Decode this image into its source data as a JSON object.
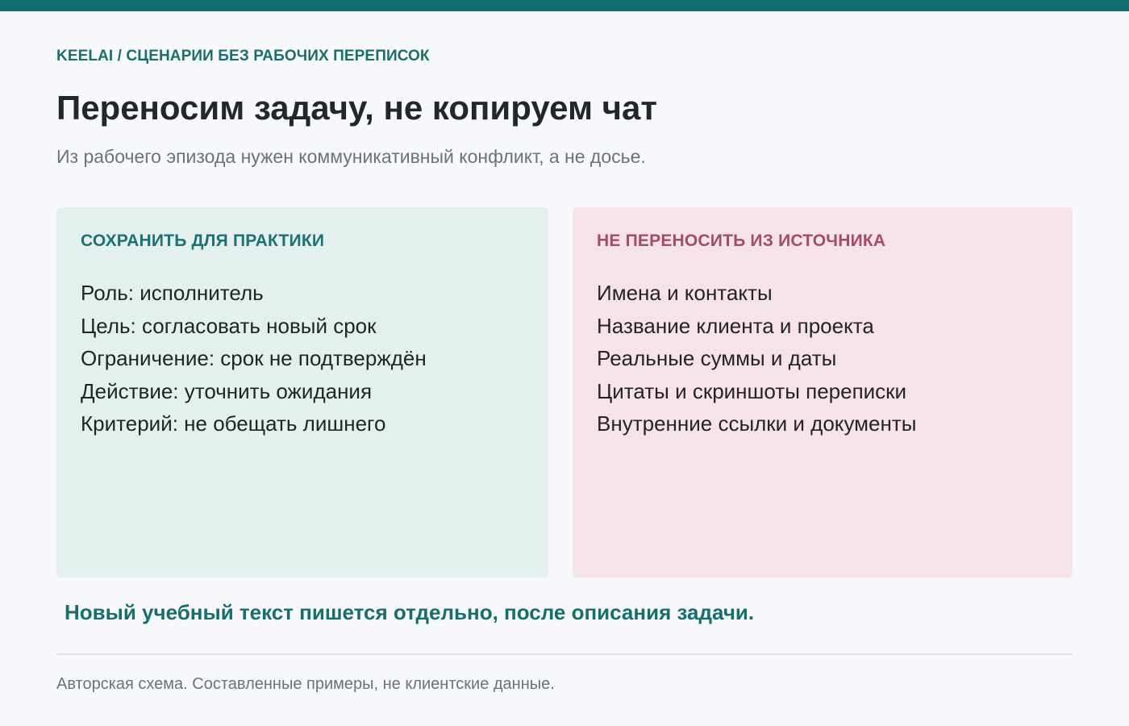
{
  "header": {
    "breadcrumb": "KEELAI / СЦЕНАРИИ БЕЗ РАБОЧИХ ПЕРЕПИСОК",
    "title": "Переносим задачу, не копируем чат",
    "subtitle": "Из рабочего эпизода нужен коммуникативный конфликт, а не досье."
  },
  "panels": {
    "keep": {
      "heading": "СОХРАНИТЬ ДЛЯ ПРАКТИКИ",
      "items": [
        "Роль: исполнитель",
        "Цель: согласовать новый срок",
        "Ограничение: срок не подтверждён",
        "Действие: уточнить ожидания",
        "Критерий: не обещать лишнего"
      ]
    },
    "exclude": {
      "heading": "НЕ ПЕРЕНОСИТЬ ИЗ ИСТОЧНИКА",
      "items": [
        "Имена и контакты",
        "Название клиента и проекта",
        "Реальные суммы и даты",
        "Цитаты и скриншоты переписки",
        "Внутренние ссылки и документы"
      ]
    }
  },
  "takeaway": "Новый учебный текст пишется отдельно, после описания задачи.",
  "footer": {
    "note": "Авторская схема. Составленные примеры, не клиентские данные."
  },
  "colors": {
    "accent": "#126e6c",
    "keep_background": "#e4f0ed",
    "keep_heading": "#1c7171",
    "exclude_background": "#f6e3e9",
    "exclude_heading": "#a24c68"
  }
}
